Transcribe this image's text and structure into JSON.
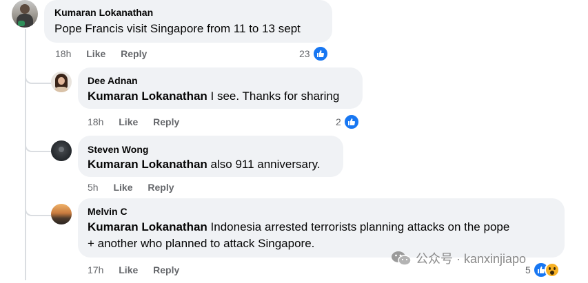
{
  "comment": {
    "author": "Kumaran Lokanathan",
    "text": "Pope Francis visit Singapore from 11 to 13 sept",
    "time": "18h",
    "like_label": "Like",
    "reply_label": "Reply",
    "reaction_count": "23"
  },
  "replies": [
    {
      "author": "Dee Adnan",
      "mention": "Kumaran Lokanathan",
      "text": " I see. Thanks for sharing",
      "time": "18h",
      "like_label": "Like",
      "reply_label": "Reply",
      "reaction_count": "2"
    },
    {
      "author": "Steven Wong",
      "mention": "Kumaran Lokanathan",
      "text": " also 911 anniversary.",
      "time": "5h",
      "like_label": "Like",
      "reply_label": "Reply"
    },
    {
      "author": "Melvin C",
      "mention": "Kumaran Lokanathan",
      "text_line1": " Indonesia arrested terrorists planning attacks on the pope",
      "text_line2": "+ another who planned to attack Singapore.",
      "time": "17h",
      "like_label": "Like",
      "reply_label": "Reply",
      "reaction_count": "5"
    }
  ],
  "watermark": {
    "text": "公众号 · kanxinjiapo",
    "icon": "wechat-icon"
  },
  "colors": {
    "bubble": "#f0f2f5",
    "like_blue": "#1877f2",
    "wow_yellow": "#f7b125",
    "meta_gray": "#65676b"
  }
}
